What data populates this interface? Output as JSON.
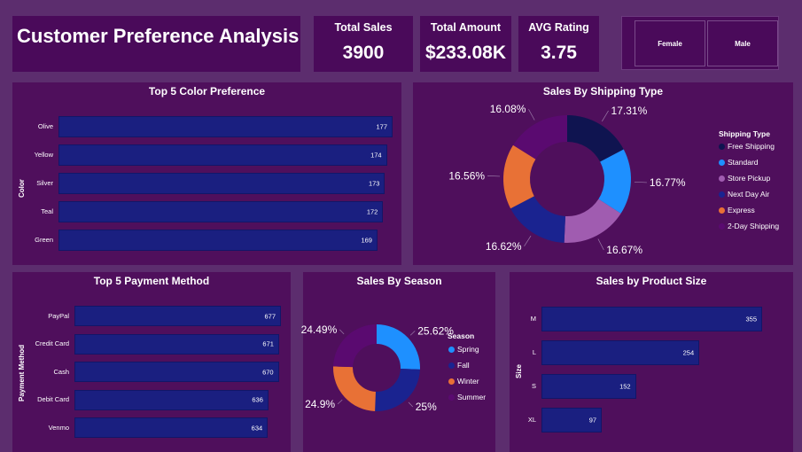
{
  "header": {
    "title": "Customer Preference Analysis"
  },
  "kpis": [
    {
      "label": "Total Sales",
      "value": "3900"
    },
    {
      "label": "Total Amount",
      "value": "$233.08K"
    },
    {
      "label": "AVG Rating",
      "value": "3.75"
    }
  ],
  "gender_slicer": {
    "options": [
      "Female",
      "Male"
    ]
  },
  "color_pref": {
    "title": "Top 5 Color Preference",
    "axis_title": "Color",
    "categories": [
      "Olive",
      "Yellow",
      "Silver",
      "Teal",
      "Green"
    ],
    "values": [
      177,
      174,
      173,
      172,
      169
    ],
    "labels": [
      "177",
      "174",
      "173",
      "172",
      "169"
    ]
  },
  "shipping": {
    "title": "Sales By Shipping Type",
    "legend_title": "Shipping Type",
    "items": [
      {
        "name": "Free Shipping",
        "pct": 17.31,
        "label": "17.31%",
        "color": "#0f1450"
      },
      {
        "name": "Standard",
        "pct": 16.77,
        "label": "16.77%",
        "color": "#1e90ff"
      },
      {
        "name": "Store Pickup",
        "pct": 16.67,
        "label": "16.67%",
        "color": "#a05cb0"
      },
      {
        "name": "Next Day Air",
        "pct": 16.62,
        "label": "16.62%",
        "color": "#1a2390"
      },
      {
        "name": "Express",
        "pct": 16.56,
        "label": "16.56%",
        "color": "#e87136"
      },
      {
        "name": "2-Day Shipping",
        "pct": 16.08,
        "label": "16.08%",
        "color": "#5a0a70"
      }
    ]
  },
  "payment": {
    "title": "Top 5 Payment Method",
    "axis_title": "Payment Method",
    "categories": [
      "PayPal",
      "Credit Card",
      "Cash",
      "Debit Card",
      "Venmo"
    ],
    "values": [
      677,
      671,
      670,
      636,
      634
    ],
    "labels": [
      "677",
      "671",
      "670",
      "636",
      "634"
    ]
  },
  "season": {
    "title": "Sales By Season",
    "legend_title": "Season",
    "items": [
      {
        "name": "Spring",
        "pct": 25.62,
        "label": "25.62%",
        "color": "#1e90ff"
      },
      {
        "name": "Fall",
        "pct": 25,
        "label": "25%",
        "color": "#1a2390"
      },
      {
        "name": "Winter",
        "pct": 24.9,
        "label": "24.9%",
        "color": "#e87136"
      },
      {
        "name": "Summer",
        "pct": 24.49,
        "label": "24.49%",
        "color": "#5a0a70"
      }
    ]
  },
  "size": {
    "title": "Sales by Product Size",
    "axis_title": "Size",
    "categories": [
      "M",
      "L",
      "S",
      "XL"
    ],
    "values": [
      355,
      254,
      152,
      97
    ],
    "labels": [
      "355",
      "254",
      "152",
      "97"
    ]
  },
  "chart_data": [
    {
      "type": "bar",
      "title": "Top 5 Color Preference",
      "ylabel": "Color",
      "categories": [
        "Olive",
        "Yellow",
        "Silver",
        "Teal",
        "Green"
      ],
      "values": [
        177,
        174,
        173,
        172,
        169
      ]
    },
    {
      "type": "pie",
      "title": "Sales By Shipping Type",
      "categories": [
        "Free Shipping",
        "Standard",
        "Store Pickup",
        "Next Day Air",
        "Express",
        "2-Day Shipping"
      ],
      "values": [
        17.31,
        16.77,
        16.67,
        16.62,
        16.56,
        16.08
      ]
    },
    {
      "type": "bar",
      "title": "Top 5 Payment Method",
      "ylabel": "Payment Method",
      "categories": [
        "PayPal",
        "Credit Card",
        "Cash",
        "Debit Card",
        "Venmo"
      ],
      "values": [
        677,
        671,
        670,
        636,
        634
      ]
    },
    {
      "type": "pie",
      "title": "Sales By Season",
      "categories": [
        "Spring",
        "Fall",
        "Winter",
        "Summer"
      ],
      "values": [
        25.62,
        25,
        24.9,
        24.49
      ]
    },
    {
      "type": "bar",
      "title": "Sales by Product Size",
      "ylabel": "Size",
      "categories": [
        "M",
        "L",
        "S",
        "XL"
      ],
      "values": [
        355,
        254,
        152,
        97
      ]
    }
  ]
}
